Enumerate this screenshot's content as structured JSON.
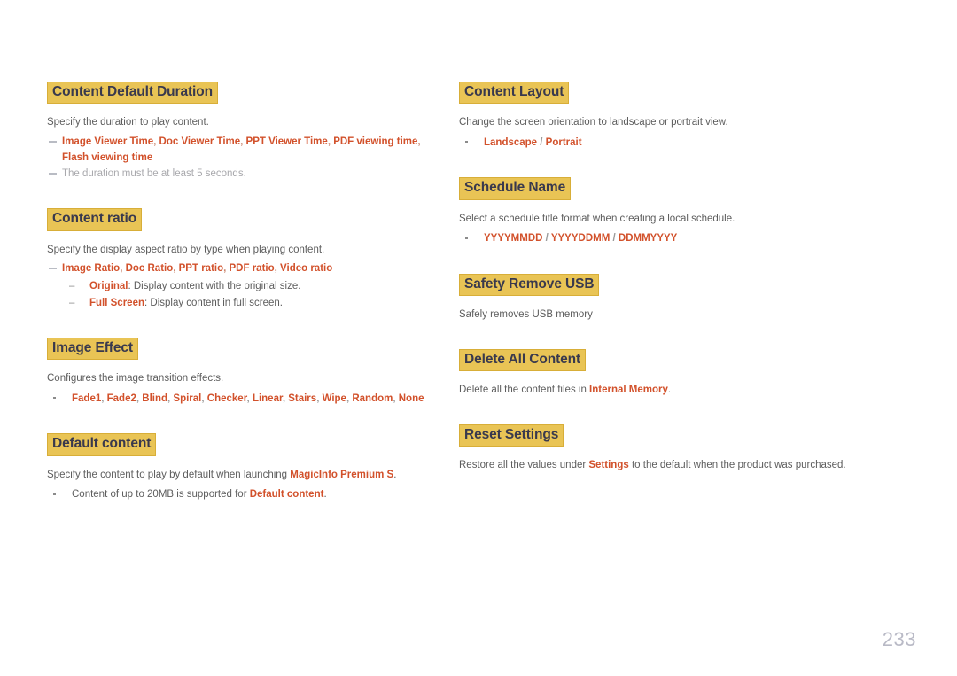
{
  "page": {
    "number": "233"
  },
  "left_column": {
    "sections": [
      {
        "heading": "Content Default Duration",
        "paragraph": "Specify the duration to play content.",
        "dash_items": [
          {
            "style": "red",
            "text": "Image Viewer Time, Doc Viewer Time, PPT Viewer Time, PDF viewing time, Flash viewing time"
          },
          {
            "style": "grey",
            "text": "The duration must be at least 5 seconds."
          }
        ]
      },
      {
        "heading": "Content ratio",
        "paragraph": "Specify the display aspect ratio by type when playing content.",
        "dash_items": [
          {
            "style": "red",
            "text": "Image Ratio, Doc Ratio, PPT ratio, PDF ratio, Video ratio"
          }
        ],
        "sub_items": [
          {
            "term": "Original",
            "rest": ": Display content with the original size."
          },
          {
            "term": "Full Screen",
            "rest": ": Display content in full screen."
          }
        ]
      },
      {
        "heading": "Image Effect",
        "paragraph": "Configures the image transition effects.",
        "bullet_items": [
          {
            "style": "red",
            "text": "Fade1, Fade2, Blind, Spiral, Checker, Linear, Stairs, Wipe, Random, None"
          }
        ]
      },
      {
        "heading": "Default content",
        "paragraph_parts": {
          "before": "Specify the content to play by default when launching ",
          "highlight": "MagicInfo Premium S",
          "after": "."
        },
        "bullet_items": [
          {
            "style": "plain",
            "before": "Content of up to 20MB is supported for ",
            "highlight": "Default content",
            "after": "."
          }
        ]
      }
    ]
  },
  "right_column": {
    "sections": [
      {
        "heading": "Content Layout",
        "paragraph": "Change the screen orientation to landscape or portrait view.",
        "bullet_items": [
          {
            "style": "red",
            "text": "Landscape / Portrait"
          }
        ]
      },
      {
        "heading": "Schedule Name",
        "paragraph": "Select a schedule title format when creating a local schedule.",
        "bullet_items": [
          {
            "style": "red",
            "text": "YYYYMMDD / YYYYDDMM / DDMMYYYY"
          }
        ]
      },
      {
        "heading": "Safety Remove USB",
        "paragraph": "Safely removes USB memory"
      },
      {
        "heading": "Delete All Content",
        "paragraph_parts": {
          "before": "Delete all the content files in ",
          "highlight": "Internal Memory",
          "after": "."
        }
      },
      {
        "heading": "Reset Settings",
        "paragraph_parts": {
          "before": "Restore all the values under ",
          "highlight": "Settings",
          "after": " to the default when the product was purchased."
        }
      }
    ]
  },
  "colors": {
    "highlight_background": "#e9c455",
    "heading_text": "#39394d",
    "accent_red": "#d2512b",
    "body_text": "#5d5d5d",
    "muted_text": "#a9a9ad",
    "page_number": "#b9bac6"
  }
}
